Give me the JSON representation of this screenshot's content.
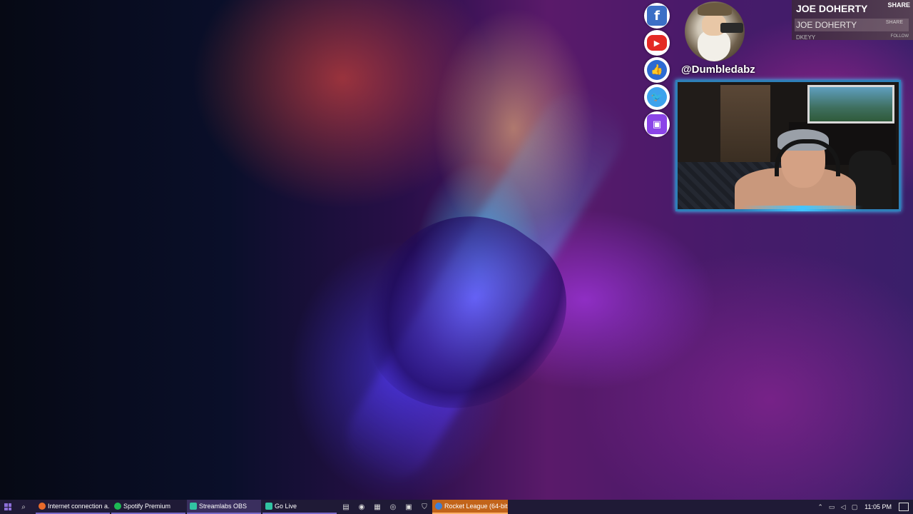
{
  "overlay": {
    "handle": "@Dumbledabz",
    "name_primary": "JOE DOHERTY",
    "name_secondary": "JOE DOHERTY",
    "share_primary": "SHARE",
    "share_secondary": "SHARE",
    "sub_line": "DKEYY",
    "follow": "FOLLOW",
    "social_icons": [
      "facebook-icon",
      "youtube-icon",
      "like-icon",
      "twitter-icon",
      "twitch-icon"
    ]
  },
  "taskbar": {
    "items": [
      {
        "label": "Internet connection a...",
        "icon": "firefox-icon",
        "color": "#e86a2a"
      },
      {
        "label": "Spotify Premium",
        "icon": "spotify-icon",
        "color": "#1db954"
      },
      {
        "label": "Streamlabs OBS",
        "icon": "streamlabs-icon",
        "color": "#31c3a2"
      },
      {
        "label": "Go Live",
        "icon": "streamlabs-icon",
        "color": "#31c3a2"
      }
    ],
    "active_item": {
      "label": "Rocket League (64-bit...",
      "icon": "rocket-league-icon",
      "color": "#3d7fd6"
    },
    "clock": "11:05 PM",
    "colors": {
      "taskbar_bg": "#1f1a36",
      "active_bg": "#c2641a",
      "accent": "#7a6ac8"
    }
  }
}
